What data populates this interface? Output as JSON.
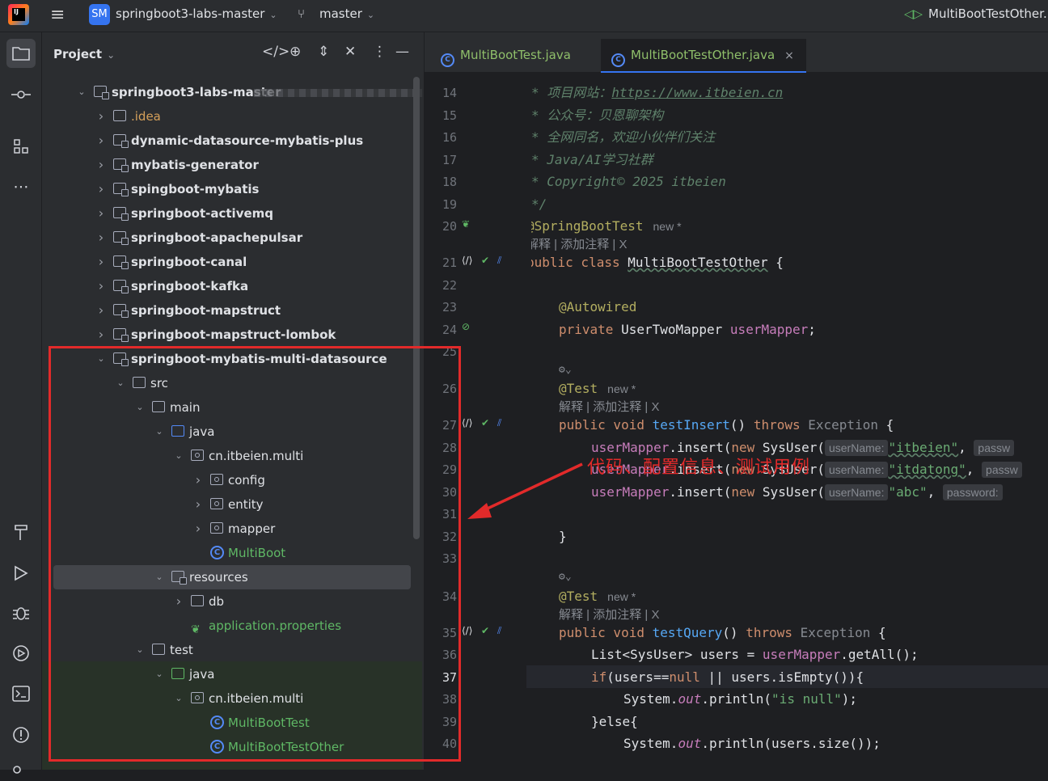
{
  "titlebar": {
    "project_badge": "SM",
    "project_name": "springboot3-labs-master",
    "branch": "master",
    "right_title": "MultiBootTestOther."
  },
  "project_panel": {
    "title": "Project",
    "tree": [
      {
        "label": "springboot3-labs-master",
        "depth": 0,
        "expanded": true,
        "icon": "module",
        "bold": true
      },
      {
        "label": ".idea",
        "depth": 1,
        "expanded": false,
        "icon": "folder",
        "color": "orange"
      },
      {
        "label": "dynamic-datasource-mybatis-plus",
        "depth": 1,
        "expanded": false,
        "icon": "module",
        "bold": true
      },
      {
        "label": "mybatis-generator",
        "depth": 1,
        "expanded": false,
        "icon": "module",
        "bold": true
      },
      {
        "label": "spingboot-mybatis",
        "depth": 1,
        "expanded": false,
        "icon": "module",
        "bold": true
      },
      {
        "label": "springboot-activemq",
        "depth": 1,
        "expanded": false,
        "icon": "module",
        "bold": true
      },
      {
        "label": "springboot-apachepulsar",
        "depth": 1,
        "expanded": false,
        "icon": "module",
        "bold": true
      },
      {
        "label": "springboot-canal",
        "depth": 1,
        "expanded": false,
        "icon": "module",
        "bold": true
      },
      {
        "label": "springboot-kafka",
        "depth": 1,
        "expanded": false,
        "icon": "module",
        "bold": true
      },
      {
        "label": "springboot-mapstruct",
        "depth": 1,
        "expanded": false,
        "icon": "module",
        "bold": true
      },
      {
        "label": "springboot-mapstruct-lombok",
        "depth": 1,
        "expanded": false,
        "icon": "module",
        "bold": true
      },
      {
        "label": "springboot-mybatis-multi-datasource",
        "depth": 1,
        "expanded": true,
        "icon": "module",
        "bold": true
      },
      {
        "label": "src",
        "depth": 2,
        "expanded": true,
        "icon": "folder"
      },
      {
        "label": "main",
        "depth": 3,
        "expanded": true,
        "icon": "folder"
      },
      {
        "label": "java",
        "depth": 4,
        "expanded": true,
        "icon": "folder-blue"
      },
      {
        "label": "cn.itbeien.multi",
        "depth": 5,
        "expanded": true,
        "icon": "package"
      },
      {
        "label": "config",
        "depth": 6,
        "expanded": false,
        "icon": "package"
      },
      {
        "label": "entity",
        "depth": 6,
        "expanded": false,
        "icon": "package"
      },
      {
        "label": "mapper",
        "depth": 6,
        "expanded": false,
        "icon": "package"
      },
      {
        "label": "MultiBoot",
        "depth": 6,
        "icon": "class",
        "color": "green"
      },
      {
        "label": "resources",
        "depth": 4,
        "expanded": true,
        "icon": "folder-res",
        "selected": true
      },
      {
        "label": "db",
        "depth": 5,
        "expanded": false,
        "icon": "folder"
      },
      {
        "label": "application.properties",
        "depth": 5,
        "icon": "spring-leaf",
        "color": "green"
      },
      {
        "label": "test",
        "depth": 3,
        "expanded": true,
        "icon": "folder"
      },
      {
        "label": "java",
        "depth": 4,
        "expanded": true,
        "icon": "folder-green"
      },
      {
        "label": "cn.itbeien.multi",
        "depth": 5,
        "expanded": true,
        "icon": "package"
      },
      {
        "label": "MultiBootTest",
        "depth": 6,
        "icon": "class",
        "color": "green"
      },
      {
        "label": "MultiBootTestOther",
        "depth": 6,
        "icon": "class",
        "color": "green"
      }
    ]
  },
  "editor": {
    "tabs": [
      {
        "label": "MultiBootTest.java",
        "active": false
      },
      {
        "label": "MultiBootTestOther.java",
        "active": true,
        "close": "×"
      }
    ],
    "line_numbers": [
      "14",
      "15",
      "16",
      "17",
      "18",
      "19",
      "20",
      "21",
      "22",
      "23",
      "24",
      "25",
      "26",
      "27",
      "28",
      "29",
      "30",
      "31",
      "32",
      "33",
      "34",
      "35",
      "36",
      "37",
      "38",
      "39",
      "40"
    ],
    "comments": {
      "site_prefix": "* 项目网站：",
      "site_url": "https://www.itbeien.cn",
      "wechat": "* 公众号：贝恩聊架构",
      "same_name": "* 全网同名，欢迎小伙伴们关注",
      "community": "* Java/AI学习社群",
      "copyright": "* Copyright© 2025 itbeien",
      "end": "*/"
    },
    "new_tag": "new *",
    "meta_links": "解释 | 添加注释 | X",
    "code": {
      "spring_boot_test": "@SpringBootTest",
      "class_kw": "public class ",
      "class_name": "MultiBootTestOther",
      "brace_open": " {",
      "autowired": "@Autowired",
      "private_kw": "private ",
      "mapper_type": "UserTwoMapper ",
      "mapper_field": "userMapper",
      "semi": ";",
      "test_ann": "@Test",
      "public_void": "public void ",
      "test_insert": "testInsert",
      "parens": "() ",
      "throws": "throws ",
      "exception": "Exception",
      "insert_call": ".insert(",
      "new_kw": "new ",
      "sys_user": "SysUser(",
      "hint_user": "userName:",
      "hint_pass": "passw",
      "hint_password": "password:",
      "str1": "\"itbeien\"",
      "str2": "\"itdatong\"",
      "str3": "\"abc\"",
      "comma": ", ",
      "close_brace": "}",
      "test_query": "testQuery",
      "list_decl": "List<SysUser> users = ",
      "get_all": ".getAll();",
      "if_kw": "if",
      "if_cond1": "(users==",
      "null_kw": "null",
      "if_cond2": " || users.isEmpty",
      "if_cond3": "()){",
      "sys_out": "System.",
      "out": "out",
      "println": ".println(",
      "is_null": "\"is null\"",
      "close_paren": ");",
      "else_open": "}else{",
      "size_call": ".println(users.size());",
      "gear": "⚙⌄"
    }
  },
  "annotation_overlay": "代码、配置信息、测试用例"
}
